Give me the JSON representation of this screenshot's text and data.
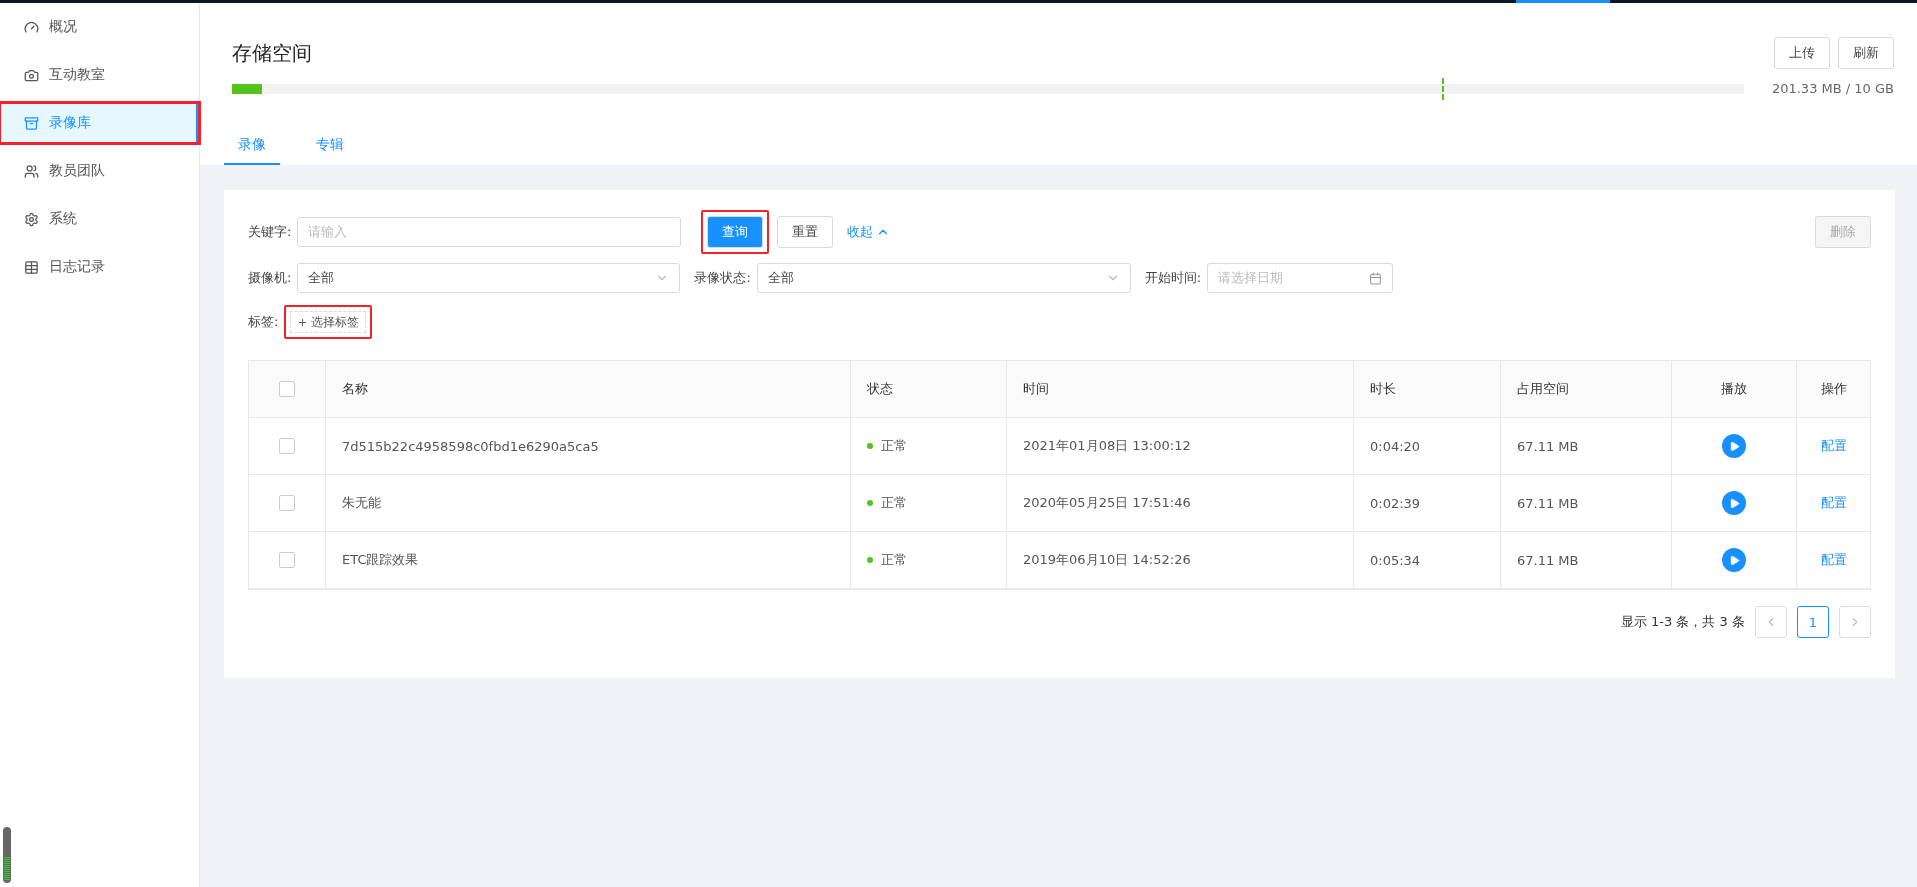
{
  "sidebar": {
    "items": [
      {
        "label": "概况",
        "selected": false,
        "highlighted": false
      },
      {
        "label": "互动教室",
        "selected": false,
        "highlighted": false
      },
      {
        "label": "录像库",
        "selected": true,
        "highlighted": true
      },
      {
        "label": "教员团队",
        "selected": false,
        "highlighted": false
      },
      {
        "label": "系统",
        "selected": false,
        "highlighted": false
      },
      {
        "label": "日志记录",
        "selected": false,
        "highlighted": false
      }
    ]
  },
  "header": {
    "title": "存储空间",
    "buttons": [
      "上传",
      "刷新"
    ],
    "storage": {
      "level": 0.02,
      "reading": "201.33 MB / 10 GB"
    }
  },
  "tabs": [
    {
      "label": "录像",
      "selected": true
    },
    {
      "label": "专辑",
      "selected": false
    }
  ],
  "filters": {
    "keyword": {
      "label": "关键字:",
      "placeholder": "请输入"
    },
    "query_button": {
      "label": "查询",
      "highlighted": true
    },
    "reset_button": "重置",
    "collapse_link": "收起",
    "delete_button": {
      "label": "删除",
      "disabled": true
    },
    "camera": {
      "label": "摄像机:",
      "value": "全部"
    },
    "status": {
      "label": "录像状态:",
      "value": "全部"
    },
    "start_time": {
      "label": "开始时间:",
      "placeholder": "请选择日期"
    },
    "tags": {
      "label": "标签:",
      "button": "选择标签",
      "highlighted": true
    }
  },
  "table": {
    "all_checked": false,
    "columns": [
      "名称",
      "状态",
      "时间",
      "时长",
      "占用空间",
      "播放",
      "操作"
    ],
    "rows": [
      {
        "checked": false,
        "name": "7d515b22c4958598c0fbd1e6290a5ca5",
        "status": "正常",
        "color": "#52c41a",
        "time": "2021年01月08日 13:00:12",
        "duration": "0:04:20",
        "size": "67.11 MB",
        "action": "配置"
      },
      {
        "checked": false,
        "name": "朱无能",
        "status": "正常",
        "color": "#52c41a",
        "time": "2020年05月25日 17:51:46",
        "duration": "0:02:39",
        "size": "67.11 MB",
        "action": "配置"
      },
      {
        "checked": false,
        "name": "ETC跟踪效果",
        "status": "正常",
        "color": "#52c41a",
        "time": "2019年06月10日 14:52:26",
        "duration": "0:05:34",
        "size": "67.11 MB",
        "action": "配置"
      }
    ]
  },
  "pagination": {
    "summary": "显示 1-3 条，共 3 条",
    "pages": [
      {
        "label": "1",
        "selected": true
      }
    ]
  }
}
